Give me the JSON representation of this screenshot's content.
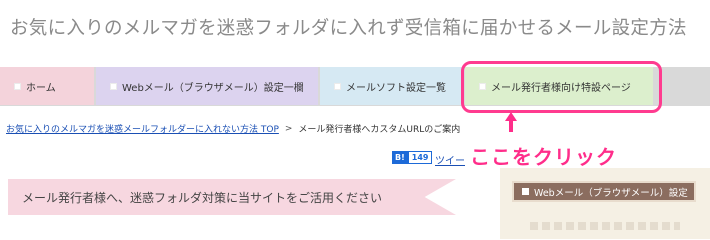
{
  "header": {
    "site_title": "お気に入りのメルマガを迷惑フォルダに入れず受信箱に届かせるメール設定方法"
  },
  "nav": {
    "tabs": [
      {
        "label": "ホーム",
        "color": "#f4d3db"
      },
      {
        "label": "Webメール（ブラウザメール）設定一欄",
        "color": "#dcd3ef"
      },
      {
        "label": "メールソフト設定一覧",
        "color": "#d6e9f3"
      },
      {
        "label": "メール発行者様向け特設ページ",
        "color": "#dcefcd"
      }
    ],
    "highlight_color": "#ff3b8f"
  },
  "breadcrumb": {
    "home_link": "お気に入りのメルマガを迷惑メールフォルダーに入れない方法 TOP",
    "separator": ">",
    "current": "メール発行者様へカスタムURLのご案内"
  },
  "social": {
    "hatebu_label": "B!",
    "hatebu_count": "149",
    "tweet_label": "ツイー"
  },
  "callout": {
    "text": "ここをクリック",
    "color": "#ff2d8a"
  },
  "banner": {
    "text": "メール発行者様へ、迷惑フォルダ対策に当サイトをご活用ください"
  },
  "sidebar": {
    "header": "Webメール（ブラウザメール）設定"
  }
}
